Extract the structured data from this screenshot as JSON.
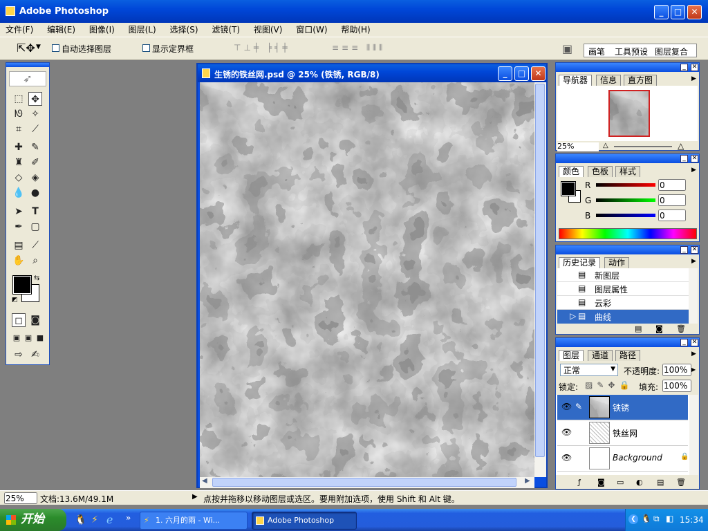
{
  "app": {
    "title": "Adobe Photoshop"
  },
  "menu": [
    "文件(F)",
    "编辑(E)",
    "图像(I)",
    "图层(L)",
    "选择(S)",
    "滤镜(T)",
    "视图(V)",
    "窗口(W)",
    "帮助(H)"
  ],
  "options": {
    "auto_select": "自动选择图层",
    "show_bounds": "显示定界框"
  },
  "well_tabs": [
    "画笔",
    "工具预设",
    "图层复合"
  ],
  "document": {
    "title": "生锈的铁丝网.psd @ 25% (铁锈, RGB/8)"
  },
  "navigator": {
    "tabs": [
      "导航器",
      "信息",
      "直方图"
    ],
    "zoom": "25%"
  },
  "color": {
    "tabs": [
      "颜色",
      "色板",
      "样式"
    ],
    "channels": [
      {
        "label": "R",
        "value": "0"
      },
      {
        "label": "G",
        "value": "0"
      },
      {
        "label": "B",
        "value": "0"
      }
    ]
  },
  "history": {
    "tabs": [
      "历史记录",
      "动作"
    ],
    "items": [
      "新图层",
      "图层属性",
      "云彩",
      "曲线"
    ]
  },
  "layers": {
    "tabs": [
      "图层",
      "通道",
      "路径"
    ],
    "blend_mode": "正常",
    "opacity_label": "不透明度:",
    "opacity": "100%",
    "lock_label": "锁定:",
    "fill_label": "填充:",
    "fill": "100%",
    "items": [
      "铁锈",
      "铁丝网",
      "Background"
    ]
  },
  "status": {
    "zoom": "25%",
    "doc": "文档:13.6M/49.1M",
    "hint": "点按并拖移以移动图层或选区。要用附加选项，使用 Shift 和 Alt 键。"
  },
  "taskbar": {
    "start": "开始",
    "tasks": [
      "1. 六月的雨 - Wi...",
      "Adobe Photoshop"
    ],
    "time": "15:34",
    "more": "»"
  }
}
